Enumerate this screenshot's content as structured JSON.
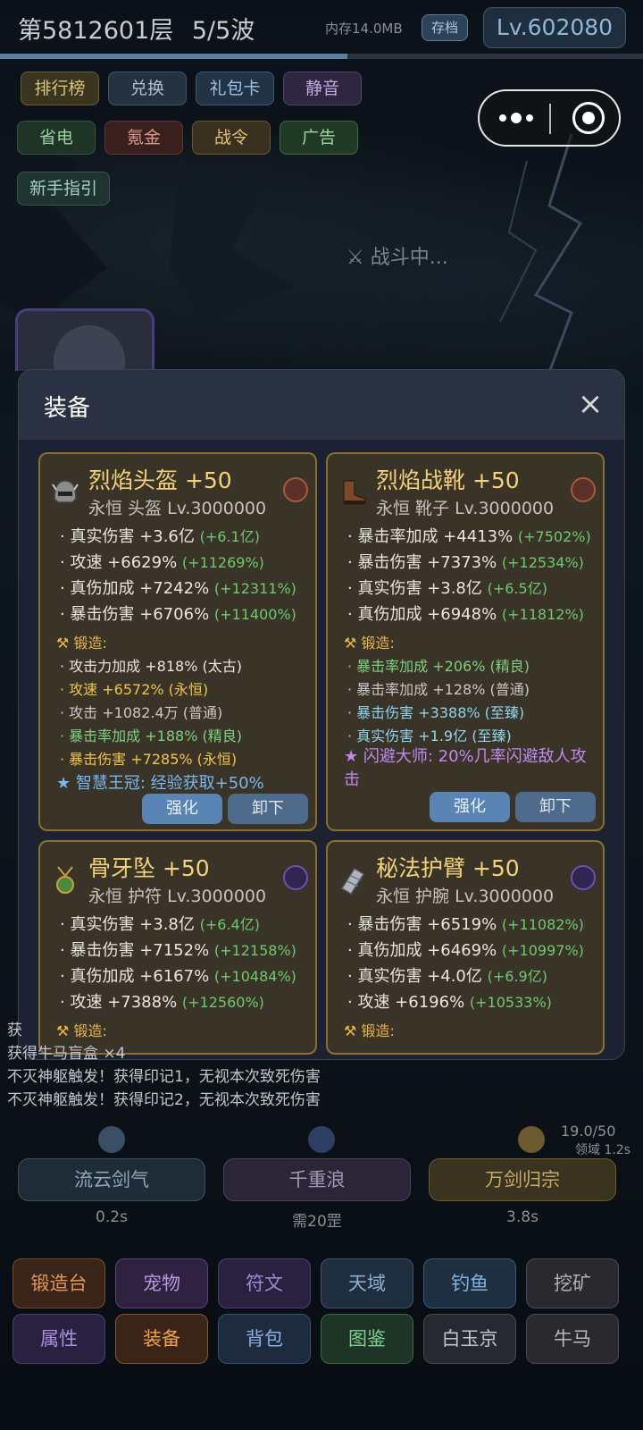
{
  "top": {
    "floor": "第5812601层",
    "wave": "5/5波",
    "memory": "内存14.0MB",
    "save": "存档",
    "level": "Lv.602080",
    "progress": 0.54
  },
  "menu_row1": [
    "排行榜",
    "兑换",
    "礼包卡",
    "静音"
  ],
  "menu_row2": [
    "省电",
    "氪金",
    "战令",
    "广告"
  ],
  "menu_row3": [
    "新手指引"
  ],
  "battle_status": "战斗中...",
  "modal": {
    "title": "装备",
    "close": "×",
    "cards": [
      {
        "name": "烈焰头盔 +50",
        "sub": "永恒  头盔   Lv.3000000",
        "stats": [
          [
            "真实伤害 +3.6亿",
            "(+6.1亿)"
          ],
          [
            "攻速 +6629%",
            "(+11269%)"
          ],
          [
            "真伤加成 +7242%",
            "(+12311%)"
          ],
          [
            "暴击伤害 +6706%",
            "(+11400%)"
          ]
        ],
        "forge": "锻造:",
        "forge_lines": [
          "攻击力加成 +818% (太古)",
          "攻速 +6572% (永恒)",
          "攻击 +1082.4万 (普通)",
          "暴击率加成 +188% (精良)",
          "暴击伤害 +7285% (永恒)"
        ],
        "skill": "★ 智慧王冠: 经验获取+50%",
        "btn_strengthen": "强化",
        "btn_unequip": "卸下"
      },
      {
        "name": "烈焰战靴 +50",
        "sub": "永恒  靴子   Lv.3000000",
        "stats": [
          [
            "暴击率加成 +4413%",
            "(+7502%)"
          ],
          [
            "暴击伤害 +7373%",
            "(+12534%)"
          ],
          [
            "真实伤害 +3.8亿",
            "(+6.5亿)"
          ],
          [
            "真伤加成 +6948%",
            "(+11812%)"
          ]
        ],
        "forge": "锻造:",
        "forge_lines": [
          "暴击率加成 +206% (精良)",
          "暴击率加成 +128% (普通)",
          "暴击伤害 +3388% (至臻)",
          "真实伤害 +1.9亿 (至臻)"
        ],
        "skill": "★ 闪避大师: 20%几率闪避敌人攻击",
        "btn_strengthen": "强化",
        "btn_unequip": "卸下"
      },
      {
        "name": "骨牙坠 +50",
        "sub": "永恒  护符   Lv.3000000",
        "stats": [
          [
            "真实伤害 +3.8亿",
            "(+6.4亿)"
          ],
          [
            "暴击伤害 +7152%",
            "(+12158%)"
          ],
          [
            "真伤加成 +6167%",
            "(+10484%)"
          ],
          [
            "攻速 +7388%",
            "(+12560%)"
          ]
        ],
        "forge": "锻造:"
      },
      {
        "name": "秘法护臂 +50",
        "sub": "永恒  护腕   Lv.3000000",
        "stats": [
          [
            "暴击伤害 +6519%",
            "(+11082%)"
          ],
          [
            "真伤加成 +6469%",
            "(+10997%)"
          ],
          [
            "真实伤害 +4.0亿",
            "(+6.9亿)"
          ],
          [
            "攻速 +6196%",
            "(+10533%)"
          ]
        ],
        "forge": "锻造:"
      }
    ]
  },
  "log": [
    "获",
    "获得牛马盲盒 ×4",
    "不灭神躯触发！获得印记1，无视本次致死伤害",
    "不灭神躯触发！获得印记2，无视本次致死伤害"
  ],
  "skills": {
    "domain_count": "19.0/50",
    "domain_time": "领域 1.2s",
    "items": [
      {
        "name": "流云剑气",
        "cd": "0.2s"
      },
      {
        "name": "千重浪",
        "cd": "需20罡"
      },
      {
        "name": "万剑归宗",
        "cd": "3.8s"
      }
    ]
  },
  "nav_row1": [
    "锻造台",
    "宠物",
    "符文",
    "天域",
    "钓鱼",
    "挖矿"
  ],
  "nav_row2": [
    "属性",
    "装备",
    "背包",
    "图鉴",
    "白玉京",
    "牛马"
  ]
}
